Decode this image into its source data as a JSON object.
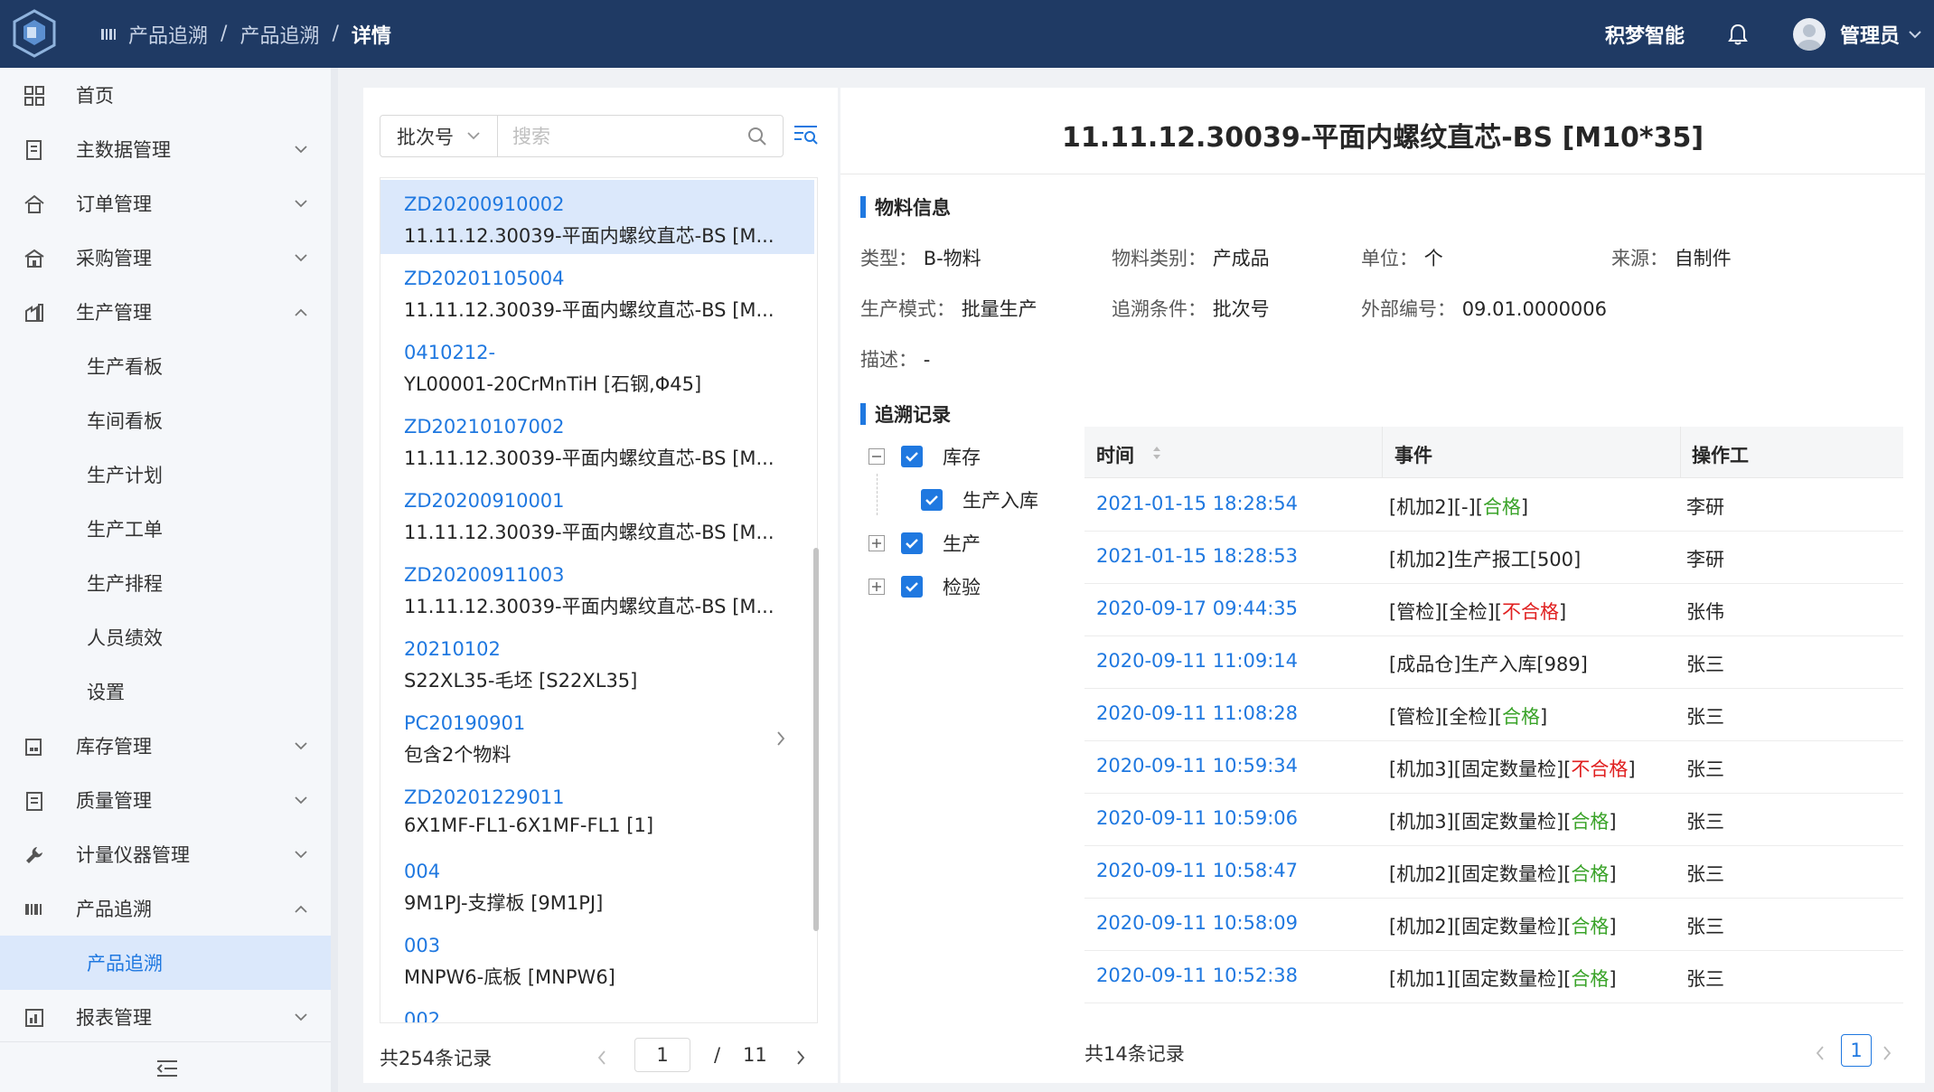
{
  "header": {
    "breadcrumb": [
      "产品追溯",
      "产品追溯",
      "详情"
    ],
    "breadcrumb_sep": "/",
    "company": "积梦智能",
    "user": "管理员"
  },
  "sidebar": {
    "items": [
      {
        "label": "首页",
        "icon": "grid-icon",
        "chevron": ""
      },
      {
        "label": "主数据管理",
        "icon": "document-icon",
        "chevron": "down"
      },
      {
        "label": "订单管理",
        "icon": "house-icon",
        "chevron": "down"
      },
      {
        "label": "采购管理",
        "icon": "shop-icon",
        "chevron": "down"
      },
      {
        "label": "生产管理",
        "icon": "factory-icon",
        "chevron": "up"
      }
    ],
    "production_subitems": [
      "生产看板",
      "车间看板",
      "生产计划",
      "生产工单",
      "生产排程",
      "人员绩效",
      "设置"
    ],
    "items2": [
      {
        "label": "库存管理",
        "icon": "warehouse-icon",
        "chevron": "down"
      },
      {
        "label": "质量管理",
        "icon": "clipboard-icon",
        "chevron": "down"
      },
      {
        "label": "计量仪器管理",
        "icon": "wrench-icon",
        "chevron": "down"
      },
      {
        "label": "产品追溯",
        "icon": "barcode-icon",
        "chevron": "up"
      }
    ],
    "trace_subitems": [
      "产品追溯"
    ],
    "items3": [
      {
        "label": "报表管理",
        "icon": "report-icon",
        "chevron": "down"
      }
    ]
  },
  "listpanel": {
    "filter_select": "批次号",
    "search_placeholder": "搜索",
    "items": [
      {
        "code": "ZD20200910002",
        "name": "11.11.12.30039-平面内螺纹直芯-BS [M..."
      },
      {
        "code": "ZD20201105004",
        "name": "11.11.12.30039-平面内螺纹直芯-BS [M..."
      },
      {
        "code": "0410212-",
        "name": "YL00001-20CrMnTiH [石钢,Φ45]"
      },
      {
        "code": "ZD20210107002",
        "name": "11.11.12.30039-平面内螺纹直芯-BS [M..."
      },
      {
        "code": "ZD20200910001",
        "name": "11.11.12.30039-平面内螺纹直芯-BS [M..."
      },
      {
        "code": "ZD20200911003",
        "name": "11.11.12.30039-平面内螺纹直芯-BS [M..."
      },
      {
        "code": "20210102",
        "name": "S22XL35-毛坯 [S22XL35]"
      },
      {
        "code": "PC20190901",
        "name": "包含2个物料"
      },
      {
        "code": "ZD20201229011",
        "name": "6X1MF-FL1-6X1MF-FL1 [1]"
      },
      {
        "code": "004",
        "name": "9M1PJ-支撑板 [9M1PJ]"
      },
      {
        "code": "003",
        "name": "MNPW6-底板 [MNPW6]"
      },
      {
        "code": "002",
        "name": ""
      }
    ],
    "total": "共254条记录",
    "page": "1",
    "page_sep": "/",
    "pages": "11"
  },
  "detail": {
    "title": "11.11.12.30039-平面内螺纹直芯-BS [M10*35]",
    "material_section": "物料信息",
    "fields": [
      {
        "key": "类型：",
        "value": "B-物料"
      },
      {
        "key": "物料类别：",
        "value": "产成品"
      },
      {
        "key": "单位：",
        "value": "个"
      },
      {
        "key": "来源：",
        "value": "自制件"
      },
      {
        "key": "生产模式：",
        "value": "批量生产"
      },
      {
        "key": "追溯条件：",
        "value": "批次号"
      },
      {
        "key": "外部编号：",
        "value": "09.01.0000006"
      },
      {
        "key": "描述：",
        "value": "-"
      }
    ],
    "trace_section": "追溯记录",
    "tree": [
      "库存",
      "生产入库",
      "生产",
      "检验"
    ],
    "table": {
      "headers": [
        "时间",
        "事件",
        "操作工"
      ],
      "rows": [
        {
          "time": "2021-01-15 18:28:54",
          "event": "[机加2][-][",
          "status": "合格",
          "status_type": "ok",
          "tail": "]",
          "operator": "李研"
        },
        {
          "time": "2021-01-15 18:28:53",
          "event": "[机加2]生产报工[500]",
          "status": "",
          "status_type": "",
          "tail": "",
          "operator": "李研"
        },
        {
          "time": "2020-09-17 09:44:35",
          "event": "[管检][全检][",
          "status": "不合格",
          "status_type": "bad",
          "tail": "]",
          "operator": "张伟"
        },
        {
          "time": "2020-09-11 11:09:14",
          "event": "[成品仓]生产入库[989]",
          "status": "",
          "status_type": "",
          "tail": "",
          "operator": "张三"
        },
        {
          "time": "2020-09-11 11:08:28",
          "event": "[管检][全检][",
          "status": "合格",
          "status_type": "ok",
          "tail": "]",
          "operator": "张三"
        },
        {
          "time": "2020-09-11 10:59:34",
          "event": "[机加3][固定数量检][",
          "status": "不合格",
          "status_type": "bad",
          "tail": "]",
          "operator": "张三"
        },
        {
          "time": "2020-09-11 10:59:06",
          "event": "[机加3][固定数量检][",
          "status": "合格",
          "status_type": "ok",
          "tail": "]",
          "operator": "张三"
        },
        {
          "time": "2020-09-11 10:58:47",
          "event": "[机加2][固定数量检][",
          "status": "合格",
          "status_type": "ok",
          "tail": "]",
          "operator": "张三"
        },
        {
          "time": "2020-09-11 10:58:09",
          "event": "[机加2][固定数量检][",
          "status": "合格",
          "status_type": "ok",
          "tail": "]",
          "operator": "张三"
        },
        {
          "time": "2020-09-11 10:52:38",
          "event": "[机加1][固定数量检][",
          "status": "合格",
          "status_type": "ok",
          "tail": "]",
          "operator": "张三"
        }
      ],
      "total": "共14条记录",
      "page": "1"
    }
  },
  "colors": {
    "header_bg": "#1f3a64",
    "accent": "#1f78e0",
    "ok": "#3aa329",
    "bad": "#e02020",
    "selected_bg": "#dbe8fb"
  }
}
